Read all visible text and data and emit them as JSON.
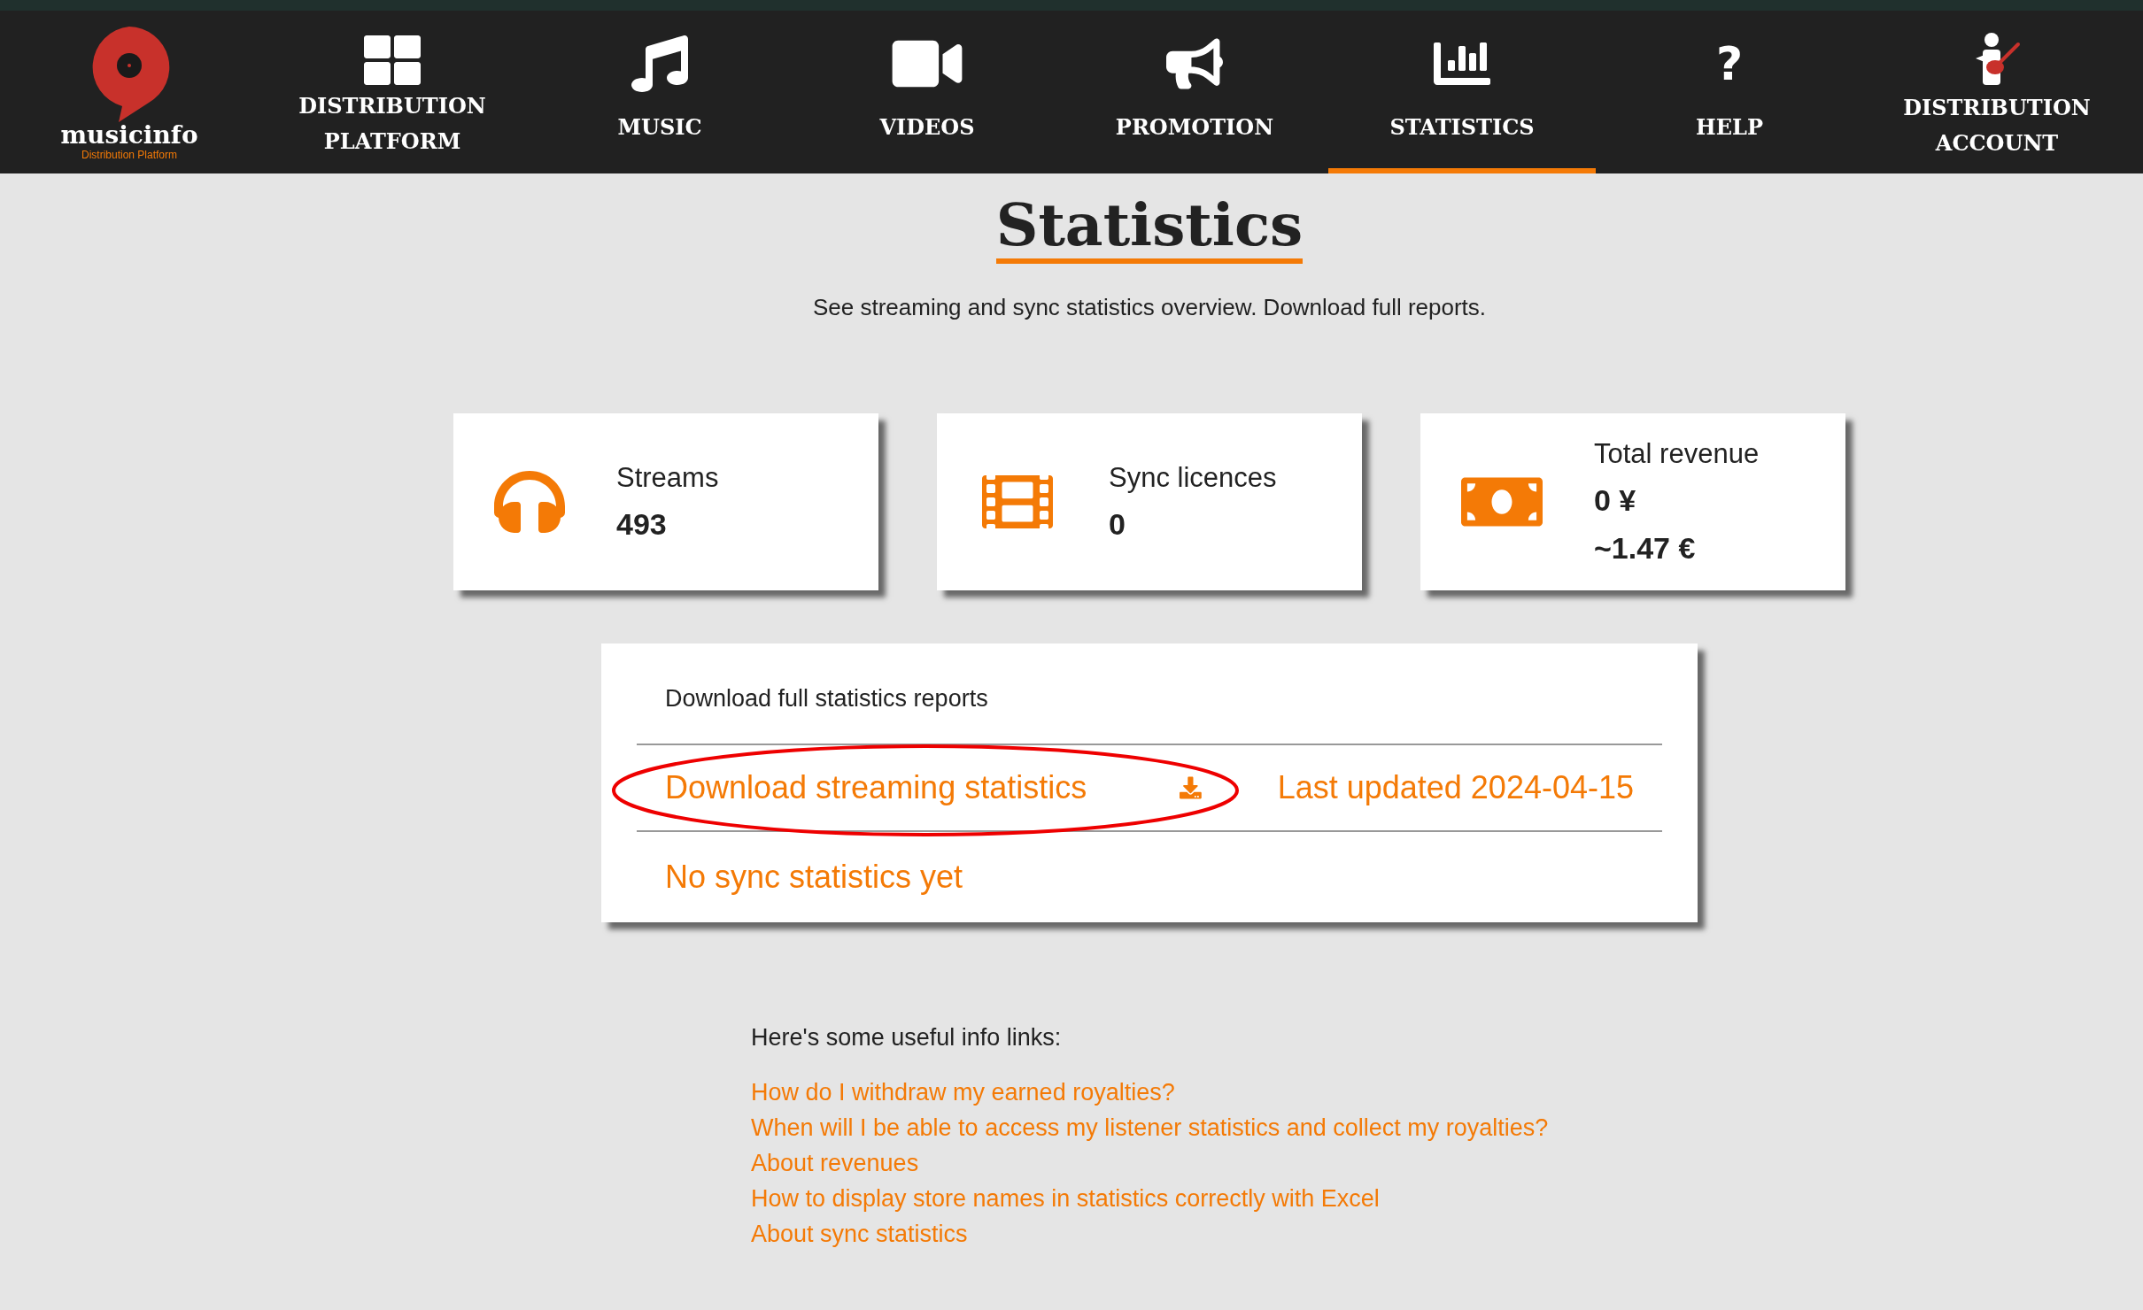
{
  "logo": {
    "name": "musicinfo",
    "tagline": "Distribution Platform"
  },
  "nav": [
    {
      "kind": "grid",
      "label": "DISTRIBUTION PLATFORM",
      "selected": false
    },
    {
      "kind": "music",
      "label": "MUSIC",
      "selected": false
    },
    {
      "kind": "video",
      "label": "VIDEOS",
      "selected": false
    },
    {
      "kind": "megaphone",
      "label": "PROMOTION",
      "selected": false
    },
    {
      "kind": "chart",
      "label": "STATISTICS",
      "selected": true
    },
    {
      "kind": "help",
      "glyph": "?",
      "label": "HELP",
      "selected": false
    },
    {
      "kind": "guitarist",
      "label": "DISTRIBUTION ACCOUNT",
      "selected": false
    }
  ],
  "title": "Statistics",
  "subtitle": "See streaming and sync statistics overview. Download full reports.",
  "cards": [
    {
      "kind": "headphones",
      "label": "Streams",
      "values": [
        "493"
      ]
    },
    {
      "kind": "film",
      "label": "Sync licences",
      "values": [
        "0"
      ]
    },
    {
      "kind": "money",
      "label": "Total revenue",
      "values": [
        "0 ¥",
        "~1.47 €"
      ]
    }
  ],
  "reports": {
    "heading": "Download full statistics reports",
    "download_link": "Download streaming statistics",
    "last_updated": "Last updated 2024-04-15",
    "sync_note": "No sync statistics yet"
  },
  "info": {
    "heading": "Here's some useful info links:",
    "links": [
      "How do I withdraw my earned royalties?",
      "When will I be able to access my listener statistics and collect my royalties?",
      "About revenues",
      "How to display store names in statistics correctly with Excel",
      "About sync statistics"
    ]
  }
}
